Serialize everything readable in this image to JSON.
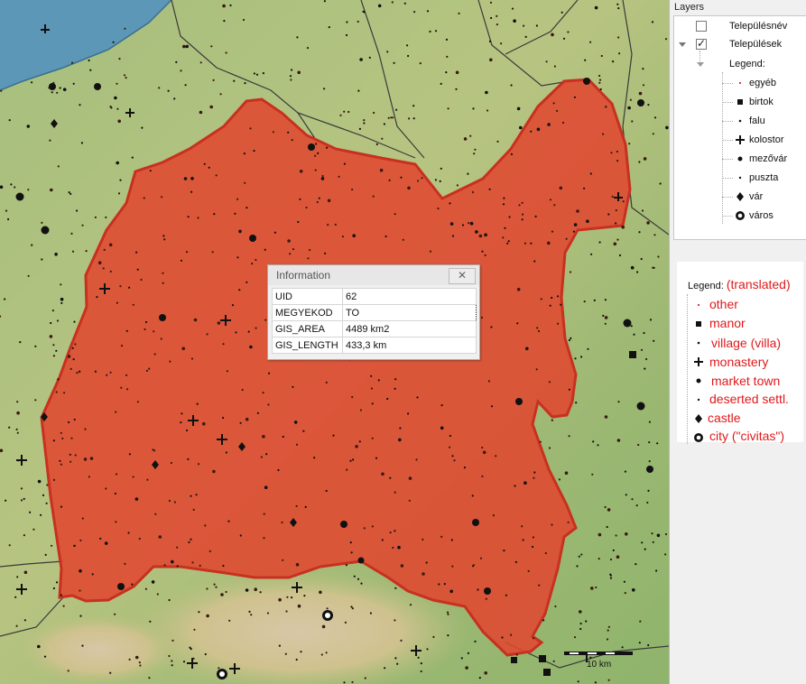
{
  "layers_panel": {
    "title": "Layers",
    "items": [
      {
        "label": "Településnév",
        "checked": false
      },
      {
        "label": "Települések",
        "checked": true
      }
    ],
    "legend_label": "Legend:",
    "legend_items": [
      {
        "label": "egyéb",
        "icon": "small-dot-icon"
      },
      {
        "label": "birtok",
        "icon": "square-icon"
      },
      {
        "label": "falu",
        "icon": "dot-icon"
      },
      {
        "label": "kolostor",
        "icon": "cross-icon"
      },
      {
        "label": "mezővár",
        "icon": "star-dot-icon"
      },
      {
        "label": "puszta",
        "icon": "small-dot-icon"
      },
      {
        "label": "vár",
        "icon": "diamond-icon"
      },
      {
        "label": "város",
        "icon": "city-ring-icon"
      }
    ]
  },
  "translated_legend": {
    "label": "Legend:",
    "note": "(translated)",
    "items": [
      "other",
      "manor",
      "village (villa)",
      "monastery",
      "market town",
      "deserted settl.",
      "castle",
      "city (\"civitas\")"
    ]
  },
  "info_window": {
    "title": "Information",
    "close_symbol": "✕",
    "rows": [
      {
        "key": "UID",
        "value": "62"
      },
      {
        "key": "MEGYEKOD",
        "value": "TO"
      },
      {
        "key": "GIS_AREA",
        "value": "4489 km2"
      },
      {
        "key": "GIS_LENGTH",
        "value": "433,3 km"
      }
    ]
  },
  "map": {
    "scale_label": "10 km",
    "region_fill_color": "#e2452f",
    "region_outline_color": "#c8301f",
    "water_color": "#5c97b8",
    "terrain_color": "#9fb977"
  }
}
